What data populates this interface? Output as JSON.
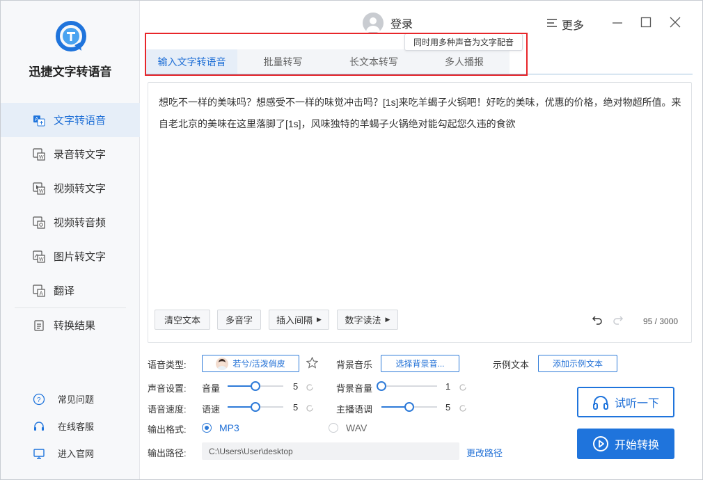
{
  "app": {
    "title": "迅捷文字转语音"
  },
  "header": {
    "login_label": "登录",
    "more_label": "更多"
  },
  "sidebar": {
    "items": [
      {
        "label": "文字转语音",
        "icon": "text-to-speech-icon",
        "active": true
      },
      {
        "label": "录音转文字",
        "icon": "recording-to-text-icon"
      },
      {
        "label": "视频转文字",
        "icon": "video-to-text-icon"
      },
      {
        "label": "视频转音频",
        "icon": "video-to-audio-icon"
      },
      {
        "label": "图片转文字",
        "icon": "image-to-text-icon"
      },
      {
        "label": "翻译",
        "icon": "translate-icon"
      },
      {
        "label": "转换结果",
        "icon": "results-icon"
      }
    ],
    "bottom_links": [
      {
        "label": "常见问题",
        "icon": "question-icon"
      },
      {
        "label": "在线客服",
        "icon": "headset-icon"
      },
      {
        "label": "进入官网",
        "icon": "monitor-icon"
      }
    ]
  },
  "tabs": [
    {
      "label": "输入文字转语音",
      "active": true
    },
    {
      "label": "批量转写"
    },
    {
      "label": "长文本转写"
    },
    {
      "label": "多人播报"
    }
  ],
  "tooltip": "同时用多种声音为文字配音",
  "editor": {
    "text": "想吃不一样的美味吗？想感受不一样的味觉冲击吗？[1s]来吃羊蝎子火锅吧！好吃的美味，优惠的价格，绝对物超所值。来自老北京的美味在这里落脚了[1s]，风味独特的羊蝎子火锅绝对能勾起您久违的食欲",
    "buttons": {
      "clear": "清空文本",
      "polyphone": "多音字",
      "insert_pause": "插入间隔",
      "number_reading": "数字读法"
    },
    "counter": "95 / 3000"
  },
  "settings": {
    "voice_type_label": "语音类型:",
    "voice_name": "若兮/活泼俏皮",
    "bg_music_label": "背景音乐",
    "bg_music_button": "选择背景音...",
    "sample_text_label": "示例文本",
    "sample_text_button": "添加示例文本",
    "sound_settings_label": "声音设置:",
    "volume_label": "音量",
    "volume_value": "5",
    "volume_level": 0.5,
    "bg_volume_label": "背景音量",
    "bg_volume_value": "1",
    "bg_volume_level": 0.0,
    "speed_row_label": "语音速度:",
    "speed_label": "语速",
    "speed_value": "5",
    "speed_level": 0.5,
    "pitch_label": "主播语调",
    "pitch_value": "5",
    "pitch_level": 0.5,
    "output_format_label": "输出格式:",
    "format_mp3": "MP3",
    "format_wav": "WAV",
    "selected_format": "MP3",
    "output_path_label": "输出路径:",
    "output_path": "C:\\Users\\User\\desktop",
    "change_path": "更改路径"
  },
  "actions": {
    "listen": "试听一下",
    "start": "开始转换"
  },
  "colors": {
    "accent": "#1f74dc",
    "highlight_box": "#e8262a"
  }
}
